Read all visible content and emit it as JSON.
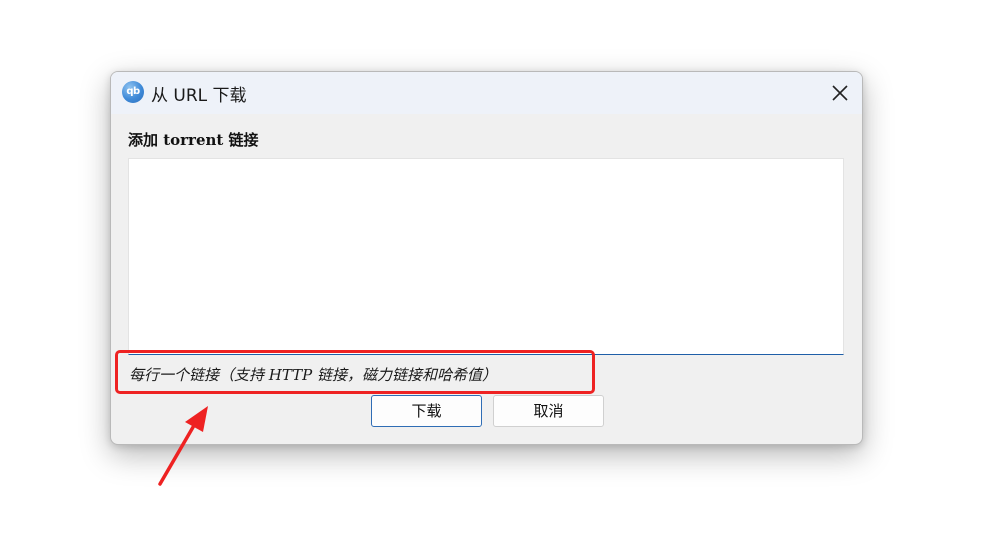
{
  "window": {
    "title": "从 URL 下载",
    "app_icon_text": "qb",
    "icon": "qbittorrent-app-icon",
    "close_icon": "close-icon"
  },
  "form": {
    "label": "添加 torrent 链接",
    "textarea_value": "",
    "hint": "每行一个链接（支持 HTTP 链接，磁力链接和哈希值）"
  },
  "buttons": {
    "download_label": "下载",
    "cancel_label": "取消"
  },
  "annotation": {
    "highlight_color": "#ee2222",
    "arrow_icon": "red-arrow-icon"
  }
}
